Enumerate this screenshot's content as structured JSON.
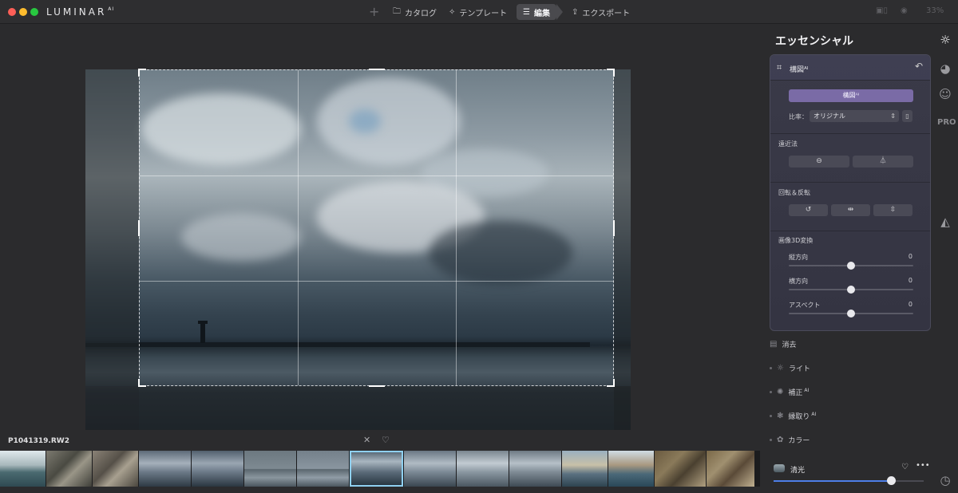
{
  "app": {
    "name": "LUMINAR",
    "superscript": "AI"
  },
  "topnav": {
    "plus": "+",
    "catalog": "カタログ",
    "templates": "テンプレート",
    "edit": "編集",
    "export": "エクスポート",
    "zoom": "33%"
  },
  "photo": {
    "filename": "P1041319.RW2"
  },
  "panel": {
    "title": "エッセンシャル",
    "crop": {
      "header": "構図ᴬᴵ",
      "primary_button": "構図ᴬᴵ",
      "ratio_label": "比率：",
      "ratio_value": "オリジナル",
      "perspective_label": "遠近法",
      "rotate_flip_label": "回転＆反転",
      "transform_label": "画像3D変換",
      "sliders": [
        {
          "label": "縦方向",
          "value": "0",
          "fraction": 0.5
        },
        {
          "label": "横方向",
          "value": "0",
          "fraction": 0.5
        },
        {
          "label": "アスペクト",
          "value": "0",
          "fraction": 0.5
        }
      ]
    },
    "tools": [
      {
        "label": "消去",
        "ai": "",
        "icon": "erase-icon"
      },
      {
        "label": "ライト",
        "ai": "",
        "icon": "light-icon"
      },
      {
        "label": "補正",
        "ai": "AI",
        "icon": "enhance-icon"
      },
      {
        "label": "縁取り",
        "ai": "AI",
        "icon": "structure-icon"
      },
      {
        "label": "カラー",
        "ai": "",
        "icon": "color-icon"
      }
    ],
    "preset": {
      "name": "清光",
      "amount_fraction": 0.78
    }
  },
  "rail": {
    "pro": "PRO"
  },
  "colors": {
    "accent": "#7a6ba6",
    "slider_fill": "#4d7ee8",
    "selection": "#8fd0f0"
  }
}
